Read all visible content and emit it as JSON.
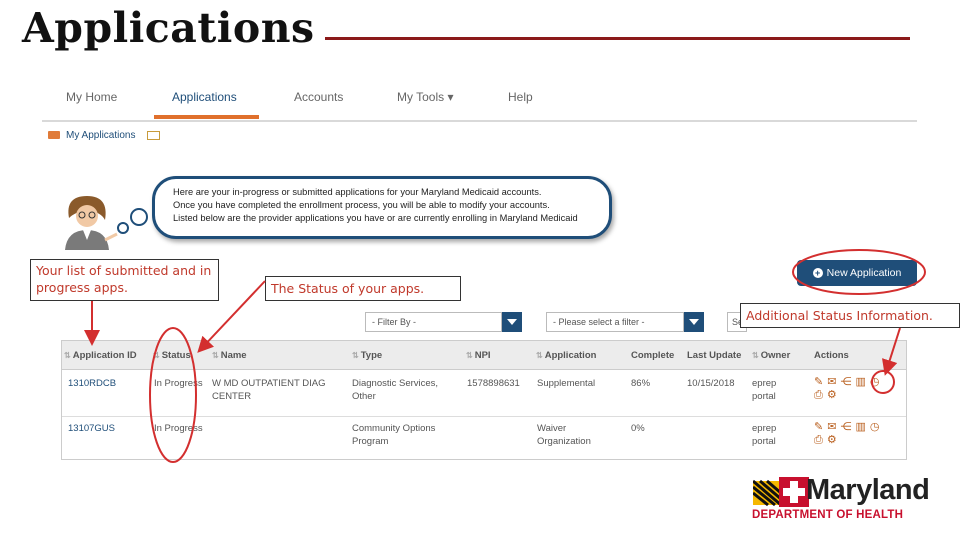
{
  "slide": {
    "title": "Applications"
  },
  "nav": {
    "items": [
      {
        "label": "My Home"
      },
      {
        "label": "Applications"
      },
      {
        "label": "Accounts"
      },
      {
        "label": "My Tools ▾"
      },
      {
        "label": "Help"
      }
    ],
    "active": "Applications"
  },
  "breadcrumb": {
    "label": "My Applications"
  },
  "bubble": {
    "lines": [
      "Here are your in-progress or submitted applications for your Maryland Medicaid accounts.",
      "Once you have completed the enrollment process, you will be able to modify your accounts.",
      "Listed below are the provider applications you have or are currently enrolling in Maryland Medicaid"
    ]
  },
  "callouts": {
    "list": "Your list of submitted and in progress apps.",
    "status": "The Status of your apps.",
    "info": "Additional Status Information."
  },
  "new_application_button": "New Application",
  "filters": {
    "filter_by": "- Filter By -",
    "select_filter": "- Please select a filter -",
    "search_placeholder": "Se"
  },
  "table": {
    "columns": [
      "Application ID",
      "Status",
      "Name",
      "Type",
      "NPI",
      "Application",
      "Complete",
      "Last Update",
      "Owner",
      "Actions"
    ],
    "rows": [
      {
        "id": "1310RDCB",
        "status": "In Progress",
        "name": "W MD OUTPATIENT DIAG CENTER",
        "type": "Diagnostic Services, Other",
        "npi": "1578898631",
        "application": "Supplemental",
        "complete": "86%",
        "last_update": "10/15/2018",
        "owner": "eprep portal"
      },
      {
        "id": "13107GUS",
        "status": "In Progress",
        "name": "",
        "type": "Community Options Program",
        "npi": "",
        "application": "Waiver Organization",
        "complete": "0%",
        "last_update": "",
        "owner": "eprep portal"
      }
    ]
  },
  "logo": {
    "name": "Maryland",
    "department": "DEPARTMENT OF HEALTH"
  },
  "colors": {
    "brand_blue": "#1f4e79",
    "accent_orange": "#e0702c",
    "annotation_red": "#d32f2f",
    "title_rule": "#8b1a1a"
  }
}
